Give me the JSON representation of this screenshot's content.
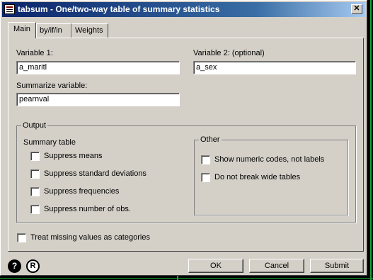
{
  "window": {
    "title": "tabsum - One/two-way table of summary statistics",
    "close_glyph": "✕"
  },
  "tabs": [
    {
      "label": "Main",
      "active": true
    },
    {
      "label": "by/if/in",
      "active": false
    },
    {
      "label": "Weights",
      "active": false
    }
  ],
  "main": {
    "variable1": {
      "label": "Variable 1:",
      "value": "a_maritl"
    },
    "variable2": {
      "label": "Variable 2: (optional)",
      "value": "a_sex"
    },
    "summarize": {
      "label": "Summarize variable:",
      "value": "pearnval"
    },
    "output": {
      "label": "Output",
      "summary_table": {
        "label": "Summary table",
        "options": [
          {
            "label": "Suppress means",
            "checked": false
          },
          {
            "label": "Suppress standard deviations",
            "checked": false
          },
          {
            "label": "Suppress frequencies",
            "checked": false
          },
          {
            "label": "Suppress number of obs.",
            "checked": false
          }
        ]
      },
      "other": {
        "label": "Other",
        "options": [
          {
            "label": "Show numeric codes, not labels",
            "checked": false
          },
          {
            "label": "Do not break wide tables",
            "checked": false
          }
        ]
      }
    },
    "missing": {
      "label": "Treat missing values as categories",
      "checked": false
    }
  },
  "footer": {
    "help_glyph": "?",
    "reset_glyph": "R",
    "ok_label": "OK",
    "cancel_label": "Cancel",
    "submit_label": "Submit"
  },
  "colors": {
    "title_start": "#0a246a",
    "title_end": "#a6caf0",
    "face": "#d4d0c8",
    "background_line": "#1e9e3a"
  }
}
